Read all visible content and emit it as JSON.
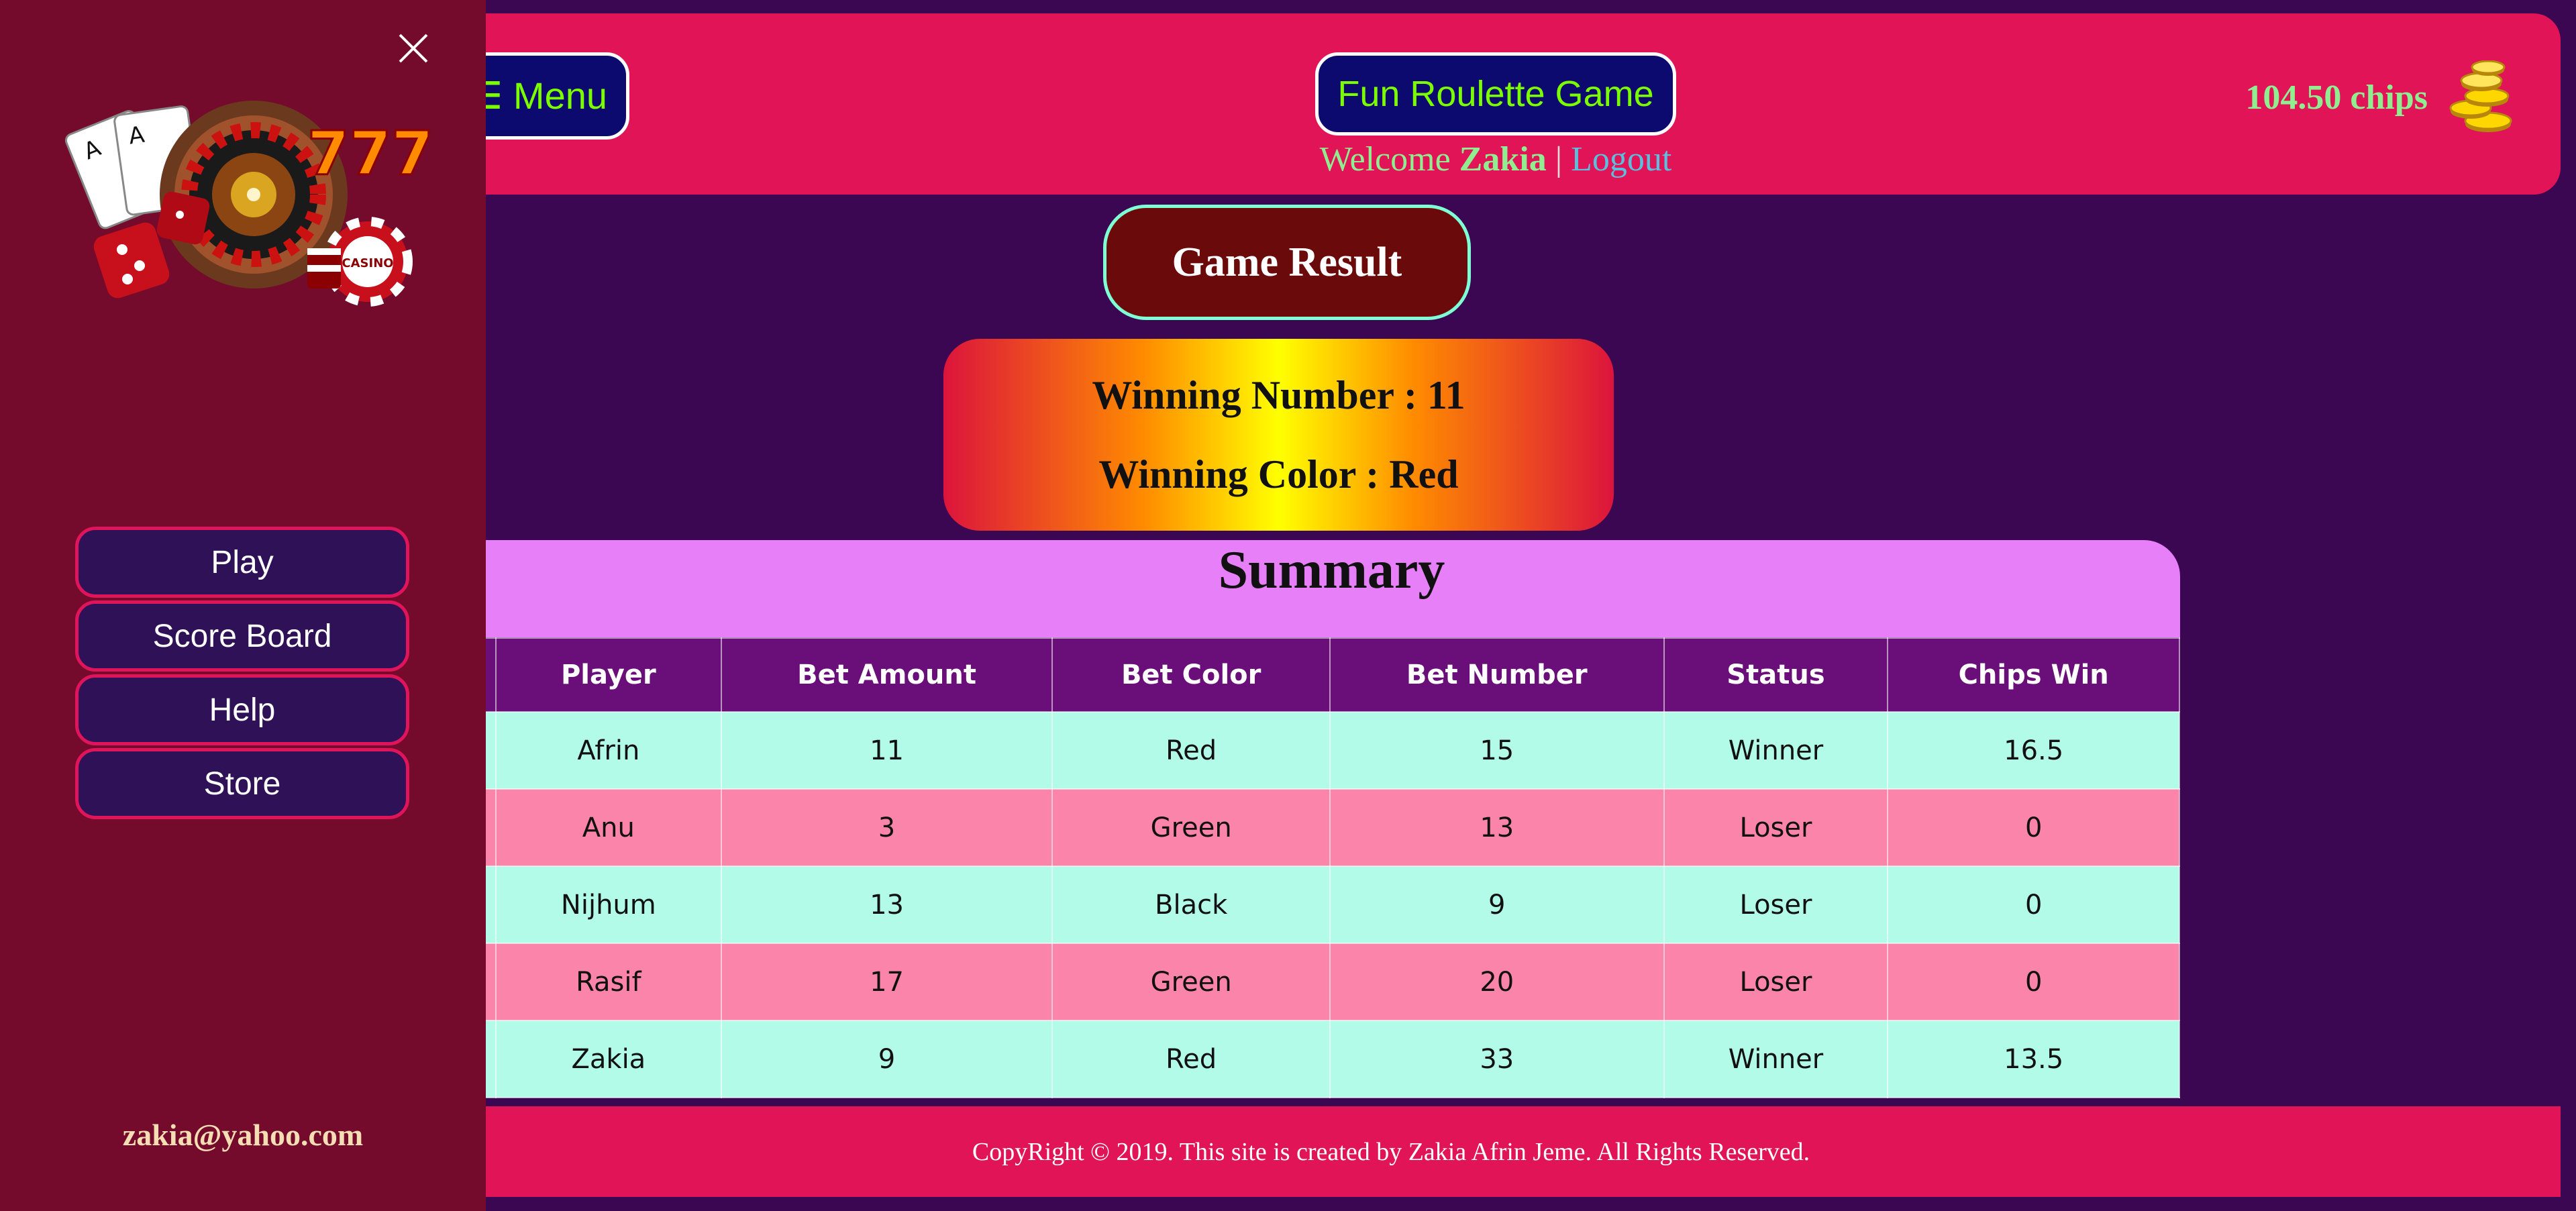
{
  "header": {
    "menu_label": "☰ Menu",
    "game_title": "Fun Roulette Game",
    "welcome_prefix": "Welcome",
    "username": "Zakia",
    "separator": "|",
    "logout_label": "Logout",
    "chips_label": "104.50 chips",
    "chips_icon": "gold-coins-icon"
  },
  "result": {
    "button_label": "Game Result",
    "winning_number_text": "Winning Number : 11",
    "winning_color_text": "Winning Color : Red"
  },
  "summary": {
    "title": "Summary",
    "columns": [
      "Player",
      "Bet Amount",
      "Bet Color",
      "Bet Number",
      "Status",
      "Chips Win"
    ],
    "rows": [
      [
        "Afrin",
        "11",
        "Red",
        "15",
        "Winner",
        "16.5"
      ],
      [
        "Anu",
        "3",
        "Green",
        "13",
        "Loser",
        "0"
      ],
      [
        "Nijhum",
        "13",
        "Black",
        "9",
        "Loser",
        "0"
      ],
      [
        "Rasif",
        "17",
        "Green",
        "20",
        "Loser",
        "0"
      ],
      [
        "Zakia",
        "9",
        "Red",
        "33",
        "Winner",
        "13.5"
      ]
    ]
  },
  "footer": {
    "copyright": "CopyRight © 2019. This site is created by Zakia Afrin Jeme. All Rights Reserved."
  },
  "sidebar": {
    "logo_icon": "casino-roulette-logo",
    "close_icon": "close-icon",
    "items": [
      {
        "label": "Play"
      },
      {
        "label": "Score Board"
      },
      {
        "label": "Help"
      },
      {
        "label": "Store"
      }
    ],
    "email": "zakia@yahoo.com"
  },
  "colors": {
    "page_bg": "#3b0652",
    "header_bg": "#e01456",
    "sidebar_bg": "#740b2c",
    "accent_green": "#7CFC00",
    "table_header": "#6a0e79",
    "row_mint": "#b3fbe9",
    "row_pink": "#fb85aa"
  }
}
